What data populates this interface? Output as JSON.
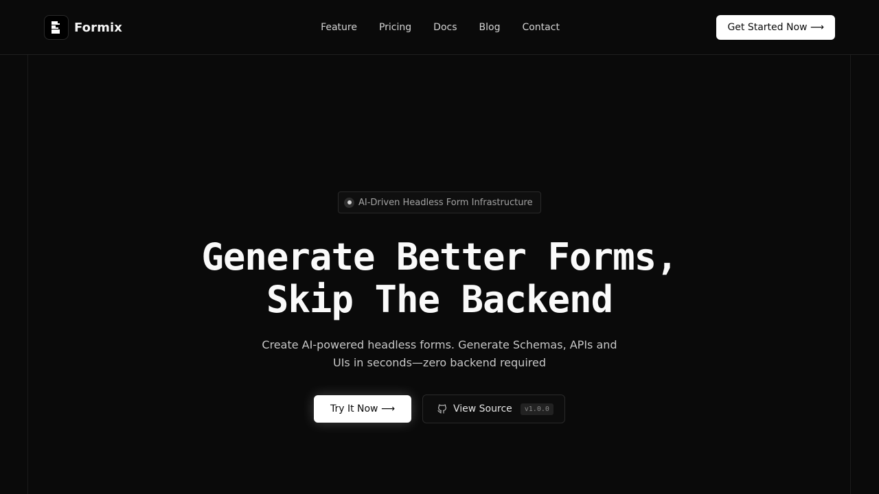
{
  "header": {
    "brand_name": "Formix",
    "logo_icon": "formix-logo-icon",
    "nav": [
      {
        "label": "Feature"
      },
      {
        "label": "Pricing"
      },
      {
        "label": "Docs"
      },
      {
        "label": "Blog"
      },
      {
        "label": "Contact"
      }
    ],
    "cta_label": "Get Started Now ⟶"
  },
  "hero": {
    "badge_text": "AI-Driven Headless Form Infrastructure",
    "headline_line1": "Generate Better Forms,",
    "headline_line2": "Skip The Backend",
    "subtitle": "Create AI-powered headless forms. Generate Schemas, APIs and UIs in seconds—zero backend required",
    "primary_button": "Try It Now ⟶",
    "secondary_button": "View Source",
    "secondary_icon": "github-icon",
    "version": "v1.0.0"
  },
  "colors": {
    "background": "#0a0a0a",
    "text": "#fafafa",
    "accent_button": "#ffffff"
  }
}
